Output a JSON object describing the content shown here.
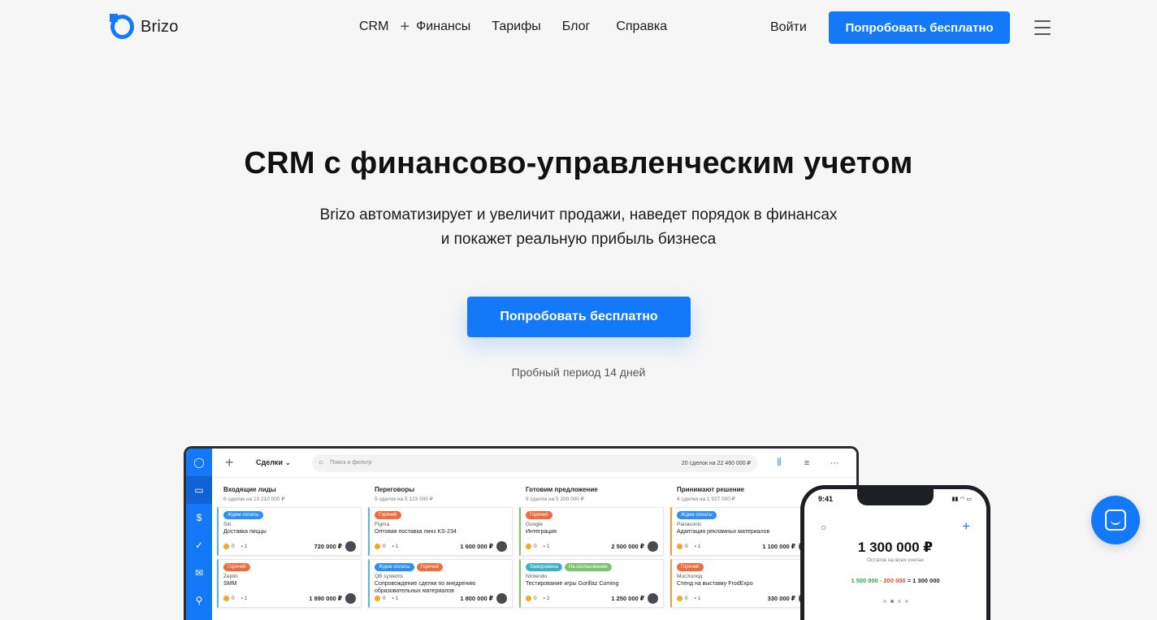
{
  "header": {
    "logo_text": "Brizo",
    "nav": {
      "crm": "CRM",
      "plus": "+",
      "finance": "Финансы",
      "tariffs": "Тарифы",
      "blog": "Блог",
      "help": "Справка"
    },
    "login": "Войти",
    "cta": "Попробовать бесплатно"
  },
  "hero": {
    "title": "CRM с финансово-управленческим учетом",
    "subtitle_line1": "Brizo автоматизирует и увеличит продажи, наведет порядок в финансах",
    "subtitle_line2": "и покажет реальную прибыль бизнеса",
    "cta": "Попробовать бесплатно",
    "trial_note": "Пробный период 14 дней"
  },
  "app": {
    "toolbar": {
      "add": "+",
      "deals": "Сделки ⌄",
      "search_placeholder": "Поиск и фильтр",
      "deals_count": "20 сделок на 22 460 000 ₽"
    },
    "columns": [
      {
        "title": "Входящие лиды",
        "summary": "6 сделок на 10 210 000 ₽",
        "cards": [
          {
            "tags": [
              {
                "label": "Ждем оплаты",
                "color": "blue"
              }
            ],
            "company": "Siri",
            "title": "Доставка пиццы",
            "tasks": "0",
            "comments": "1",
            "amount": "720 000 ₽"
          },
          {
            "tags": [
              {
                "label": "Горячий",
                "color": "red"
              }
            ],
            "company": "Zeplin",
            "title": "SMM",
            "tasks": "0",
            "comments": "1",
            "amount": "1 890 000 ₽"
          }
        ]
      },
      {
        "title": "Переговоры",
        "summary": "5 сделок на 5 123 000 ₽",
        "cards": [
          {
            "tags": [
              {
                "label": "Горячий",
                "color": "red"
              }
            ],
            "company": "Figma",
            "title": "Оптовая поставка линз KS-234",
            "tasks": "0",
            "comments": "1",
            "amount": "1 600 000 ₽"
          },
          {
            "tags": [
              {
                "label": "Ждем оплаты",
                "color": "blue"
              },
              {
                "label": "Горячий",
                "color": "red"
              }
            ],
            "company": "QB systems",
            "title": "Сопровождение сделки по внедрению образовательных материалов",
            "tasks": "0",
            "comments": "1",
            "amount": "1 800 000 ₽"
          }
        ]
      },
      {
        "title": "Готовим предложение",
        "summary": "5 сделок на 5 200 000 ₽",
        "cards": [
          {
            "tags": [
              {
                "label": "Горячий",
                "color": "red"
              }
            ],
            "company": "Google",
            "title": "Интеграция",
            "tasks": "0",
            "comments": "1",
            "amount": "2 500 000 ₽"
          },
          {
            "tags": [
              {
                "label": "Заморожена",
                "color": "teal"
              },
              {
                "label": "На согласовании",
                "color": "green"
              }
            ],
            "company": "Nintendo",
            "title": "Тестирование игры Gorillaz Coming",
            "tasks": "0",
            "comments": "2",
            "amount": "1 250 000 ₽"
          }
        ]
      },
      {
        "title": "Принимают решение",
        "summary": "4 сделки на 1 927 000 ₽",
        "cards": [
          {
            "tags": [
              {
                "label": "Ждем оплаты",
                "color": "blue"
              }
            ],
            "company": "Panasonic",
            "title": "Адаптация рекламных материалов",
            "tasks": "0",
            "comments": "1",
            "amount": "1 100 000 ₽"
          },
          {
            "tags": [
              {
                "label": "Горячий",
                "color": "red"
              }
            ],
            "company": "МосХолод",
            "title": "Стенд на выставку FrodExpo",
            "tasks": "0",
            "comments": "1",
            "amount": "330 000 ₽"
          }
        ]
      }
    ]
  },
  "phone": {
    "time": "9:41",
    "balance": "1 300 000 ₽",
    "balance_label": "Остаток на всех счетах",
    "income": "1 500 000",
    "expense": "- 200 000",
    "result": "= 1 300 000"
  },
  "colors": {
    "accent": "#1479f8",
    "hot": "#f06a3c",
    "positive": "#2aa84a",
    "negative": "#e24a3b"
  }
}
